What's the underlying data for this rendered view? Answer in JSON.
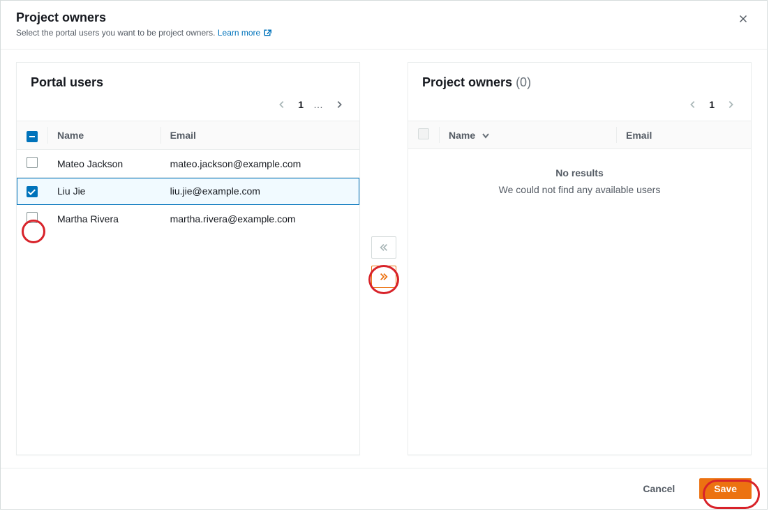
{
  "modal": {
    "title": "Project owners",
    "subtitle": "Select the portal users you want to be project owners.",
    "learn_more": "Learn more"
  },
  "portal_users": {
    "title": "Portal users",
    "columns": {
      "name": "Name",
      "email": "Email"
    },
    "pagination": {
      "page": "1",
      "ellipsis": "…"
    },
    "rows": [
      {
        "name": "Mateo Jackson",
        "email": "mateo.jackson@example.com",
        "checked": false
      },
      {
        "name": "Liu Jie",
        "email": "liu.jie@example.com",
        "checked": true
      },
      {
        "name": "Martha Rivera",
        "email": "martha.rivera@example.com",
        "checked": false
      }
    ]
  },
  "project_owners": {
    "title": "Project owners",
    "count": "(0)",
    "columns": {
      "name": "Name",
      "email": "Email"
    },
    "pagination": {
      "page": "1"
    },
    "empty": {
      "title": "No results",
      "subtitle": "We could not find any available users"
    }
  },
  "footer": {
    "cancel": "Cancel",
    "save": "Save"
  }
}
